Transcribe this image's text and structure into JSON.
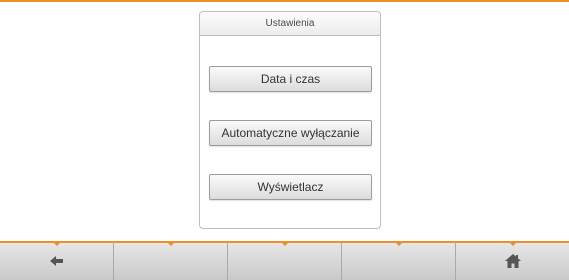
{
  "settings": {
    "title": "Ustawienia",
    "buttons": [
      {
        "label": "Data i czas"
      },
      {
        "label": "Automatyczne wyłączanie"
      },
      {
        "label": "Wyświetlacz"
      }
    ]
  },
  "navbar": {
    "items": [
      {
        "icon": "back-arrow-icon"
      },
      {
        "icon": ""
      },
      {
        "icon": ""
      },
      {
        "icon": ""
      },
      {
        "icon": "home-icon"
      }
    ]
  },
  "colors": {
    "accent": "#ee8f2a",
    "icon": "#555555"
  }
}
